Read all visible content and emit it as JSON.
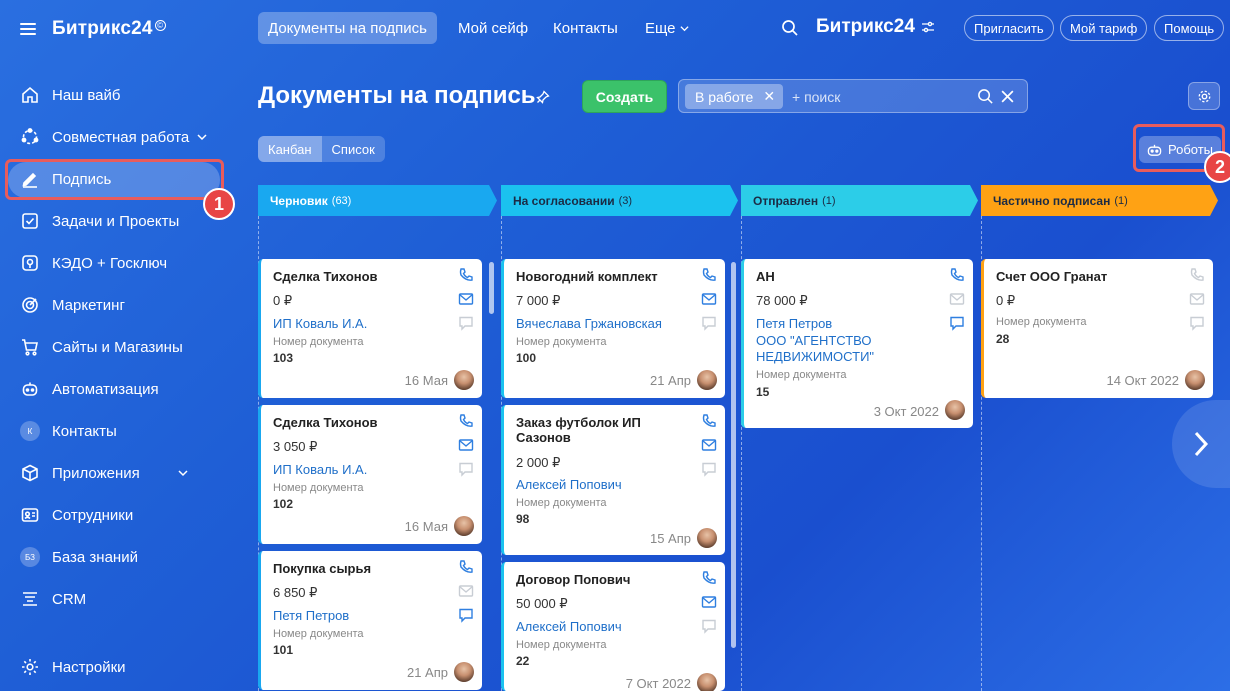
{
  "sidebar": {
    "logo": "Битрикс24",
    "logo_mark": "©",
    "items": [
      {
        "label": "Наш вайб",
        "icon": "home-icon"
      },
      {
        "label": "Совместная работа",
        "icon": "collab-icon"
      },
      {
        "label": "Подпись",
        "icon": "sign-pen-icon"
      },
      {
        "label": "Задачи и Проекты",
        "icon": "tasks-icon"
      },
      {
        "label": "КЭДО + Госключ",
        "icon": "kedo-icon"
      },
      {
        "label": "Маркетинг",
        "icon": "marketing-icon"
      },
      {
        "label": "Сайты и Магазины",
        "icon": "cart-icon"
      },
      {
        "label": "Автоматизация",
        "icon": "robot-icon"
      },
      {
        "label": "Контакты",
        "icon": "contacts-icon",
        "badge": "К"
      },
      {
        "label": "Приложения",
        "icon": "apps-icon"
      },
      {
        "label": "Сотрудники",
        "icon": "employees-icon"
      },
      {
        "label": "База знаний",
        "icon": "knowledge-icon",
        "badge": "БЗ"
      },
      {
        "label": "CRM",
        "icon": "crm-icon"
      }
    ],
    "settings": "Настройки"
  },
  "topbar": {
    "tabs": [
      "Документы на подпись",
      "Мой сейф",
      "Контакты",
      "Еще"
    ],
    "brand": "Битрикс24",
    "invite": "Пригласить",
    "tariff": "Мой тариф",
    "help": "Помощь"
  },
  "page": {
    "title": "Документы на подпись",
    "create": "Создать",
    "filter_chip": "В работе",
    "search_placeholder": "+ поиск",
    "view_kanban": "Канбан",
    "view_list": "Список",
    "robots": "Роботы"
  },
  "callouts": [
    "1",
    "2"
  ],
  "columns": [
    {
      "name": "Черновик",
      "count": "(63)",
      "color": "#19a8f0",
      "text_color": "#ffffff"
    },
    {
      "name": "На согласовании",
      "count": "(3)",
      "color": "#1bc2ef",
      "text_color": "#1b2b44"
    },
    {
      "name": "Отправлен",
      "count": "(1)",
      "color": "#2ccde8",
      "text_color": "#1b2b44"
    },
    {
      "name": "Частично подписан",
      "count": "(1)",
      "color": "#ffa214",
      "text_color": "#1b2b44"
    }
  ],
  "cards": [
    {
      "title": "Сделка Тихонов",
      "price": "0 ₽",
      "client": "ИП Коваль И.А.",
      "doc_label": "Номер документа",
      "doc_num": "103",
      "date": "16 Мая"
    },
    {
      "title": "Сделка Тихонов",
      "price": "3 050 ₽",
      "client": "ИП Коваль И.А.",
      "doc_label": "Номер документа",
      "doc_num": "102",
      "date": "16 Мая"
    },
    {
      "title": "Покупка сырья",
      "price": "6 850 ₽",
      "client": "Петя Петров",
      "doc_label": "Номер документа",
      "doc_num": "101",
      "date": "21 Апр"
    },
    {
      "title": "Новогодний комплект",
      "price": "7 000 ₽",
      "client": "Вячеслава Гржановская",
      "doc_label": "Номер документа",
      "doc_num": "100",
      "date": "21 Апр"
    },
    {
      "title": "Заказ футболок ИП Сазонов",
      "price": "2 000 ₽",
      "client": "Алексей Попович",
      "doc_label": "Номер документа",
      "doc_num": "98",
      "date": "15 Апр"
    },
    {
      "title": "Договор Попович",
      "price": "50 000 ₽",
      "client": "Алексей Попович",
      "doc_label": "Номер документа",
      "doc_num": "22",
      "date": "7 Окт 2022"
    },
    {
      "title": "АН",
      "price": "78 000 ₽",
      "client": "Петя Петров",
      "client2": "ООО \"АГЕНТСТВО НЕДВИЖИМОСТИ\"",
      "doc_label": "Номер документа",
      "doc_num": "15",
      "date": "3 Окт 2022"
    },
    {
      "title": "Счет ООО Гранат",
      "price": "0 ₽",
      "client": "",
      "doc_label": "Номер документа",
      "doc_num": "28",
      "date": "14 Окт 2022"
    }
  ]
}
